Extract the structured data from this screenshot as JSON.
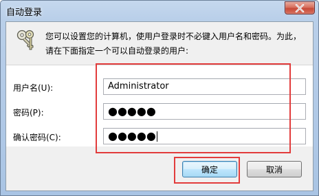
{
  "window": {
    "title": "自动登录"
  },
  "description": {
    "line1": "您可以设置您的计算机，使用户登录时不必键入用户名和密码。为此，",
    "line2": "请在下面指定一个可以自动登录的用户:"
  },
  "form": {
    "username_label": "用户名(U):",
    "username_value": "Administrator",
    "password_label": "密码(P):",
    "password_value": "●●●●●",
    "confirm_label": "确认密码(C):",
    "confirm_value": "●●●●●"
  },
  "buttons": {
    "ok_label": "确定",
    "cancel_label": "取消"
  },
  "colors": {
    "highlight_box": "#e23b3b",
    "titlebar": "#b9cfe9",
    "close_button": "#c74a38"
  },
  "icons": {
    "header_icon": "keys-icon",
    "close_icon": "close-icon"
  }
}
